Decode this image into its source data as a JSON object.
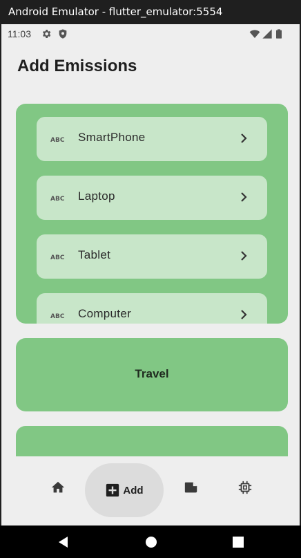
{
  "window": {
    "title": "Android Emulator - flutter_emulator:5554"
  },
  "status_bar": {
    "time": "11:03",
    "left_icons": [
      "gear-icon",
      "shield-icon"
    ],
    "right_icons": [
      "wifi-icon",
      "signal-icon",
      "battery-icon"
    ]
  },
  "page": {
    "title": "Add Emissions"
  },
  "devices": {
    "items": [
      {
        "label": "SmartPhone",
        "leading_icon": "abc-icon",
        "trailing_icon": "chevron-right-icon"
      },
      {
        "label": "Laptop",
        "leading_icon": "abc-icon",
        "trailing_icon": "chevron-right-icon"
      },
      {
        "label": "Tablet",
        "leading_icon": "abc-icon",
        "trailing_icon": "chevron-right-icon"
      },
      {
        "label": "Computer",
        "leading_icon": "abc-icon",
        "trailing_icon": "chevron-right-icon"
      }
    ]
  },
  "travel": {
    "label": "Travel"
  },
  "bottom_nav": {
    "items": [
      {
        "icon": "home-icon",
        "label": ""
      },
      {
        "icon": "add-box-icon",
        "label": "Add",
        "selected": true
      },
      {
        "icon": "label-icon",
        "label": ""
      },
      {
        "icon": "chip-icon",
        "label": ""
      }
    ]
  },
  "system_nav": {
    "buttons": [
      "back-icon",
      "home-circle-icon",
      "recents-icon"
    ]
  },
  "colors": {
    "background": "#eeeeee",
    "card_green": "#81c784",
    "item_green": "#c8e6c9",
    "nav_indicator": "#dcdcdc"
  }
}
